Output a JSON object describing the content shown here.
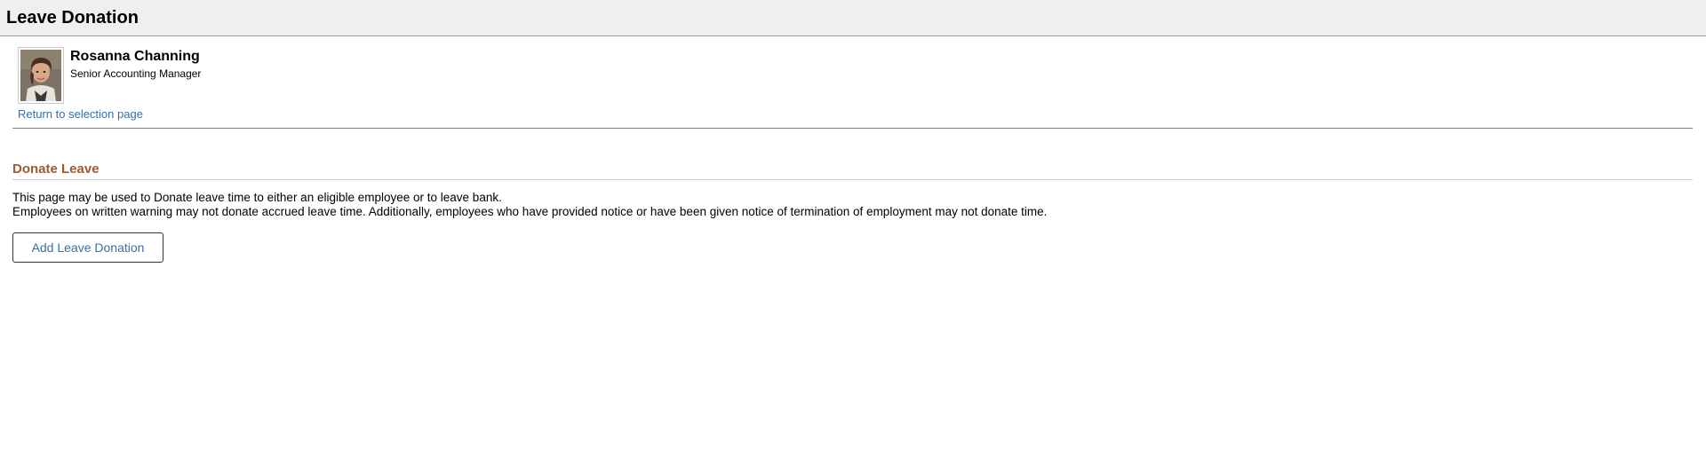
{
  "header": {
    "title": "Leave Donation"
  },
  "employee": {
    "name": "Rosanna Channing",
    "job_title": "Senior Accounting Manager",
    "return_link": "Return to selection page"
  },
  "section": {
    "title": "Donate Leave",
    "description_line1": "This page may be used to Donate leave time to either an eligible employee or to leave bank.",
    "description_line2": "Employees on written warning may not donate accrued leave time. Additionally, employees who have provided notice or have been given notice of termination of employment may not donate time.",
    "add_button": "Add Leave Donation"
  },
  "colors": {
    "section_title": "#9b5a33",
    "link": "#3a6ea5",
    "header_bg": "#f0efee"
  }
}
